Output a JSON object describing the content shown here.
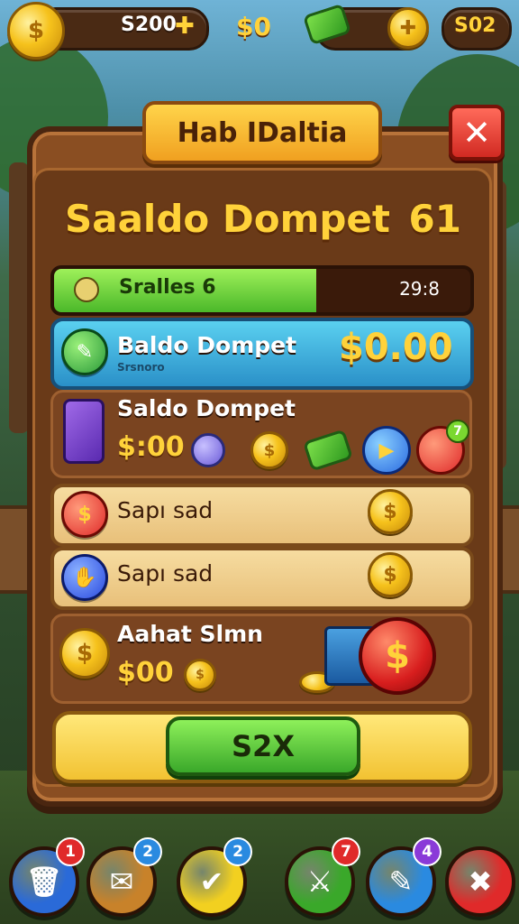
{
  "top_bar": {
    "coins_value": "S200",
    "cash_value": "$0",
    "gems_value": "S02"
  },
  "panel": {
    "tab_title": "Hab IDaltia",
    "close_symbol": "✕",
    "title": "Saaldo Dompet",
    "title_number": "61"
  },
  "progress": {
    "label": "Sralles 6",
    "time": "29:8",
    "fill_percent": 63
  },
  "balance_row": {
    "label": "Baldo Dompet",
    "sublabel": "Srsnoro",
    "amount": "$0.00"
  },
  "inventory_row": {
    "label": "Saldo Dompet",
    "amount": "$:00",
    "badge_count": "7"
  },
  "reward_rows": [
    {
      "label": "Sapı sad"
    },
    {
      "label": "Sapı sad"
    }
  ],
  "shop_row": {
    "label": "Aahat Slmn",
    "amount": "$00"
  },
  "claim_button": {
    "label": "S2X"
  },
  "bottom_nav": [
    {
      "icon": "trash-icon",
      "badge": "1",
      "color": "#2a6ad8",
      "badge_color": "#e02a2a"
    },
    {
      "icon": "scroll-icon",
      "badge": "2",
      "color": "#c8822a",
      "badge_color": "#2a8ae0"
    },
    {
      "icon": "check-icon",
      "badge": "2",
      "color": "#f2d020",
      "badge_color": "#2a8ae0"
    },
    {
      "icon": "sword-icon",
      "badge": "7",
      "color": "#3aa82a",
      "badge_color": "#e02a2a"
    },
    {
      "icon": "broom-icon",
      "badge": "4",
      "color": "#2a8ae0",
      "badge_color": "#8a3ad8"
    },
    {
      "icon": "cancel-icon",
      "badge": "",
      "color": "#e02a2a",
      "badge_color": "#f2c232"
    }
  ]
}
